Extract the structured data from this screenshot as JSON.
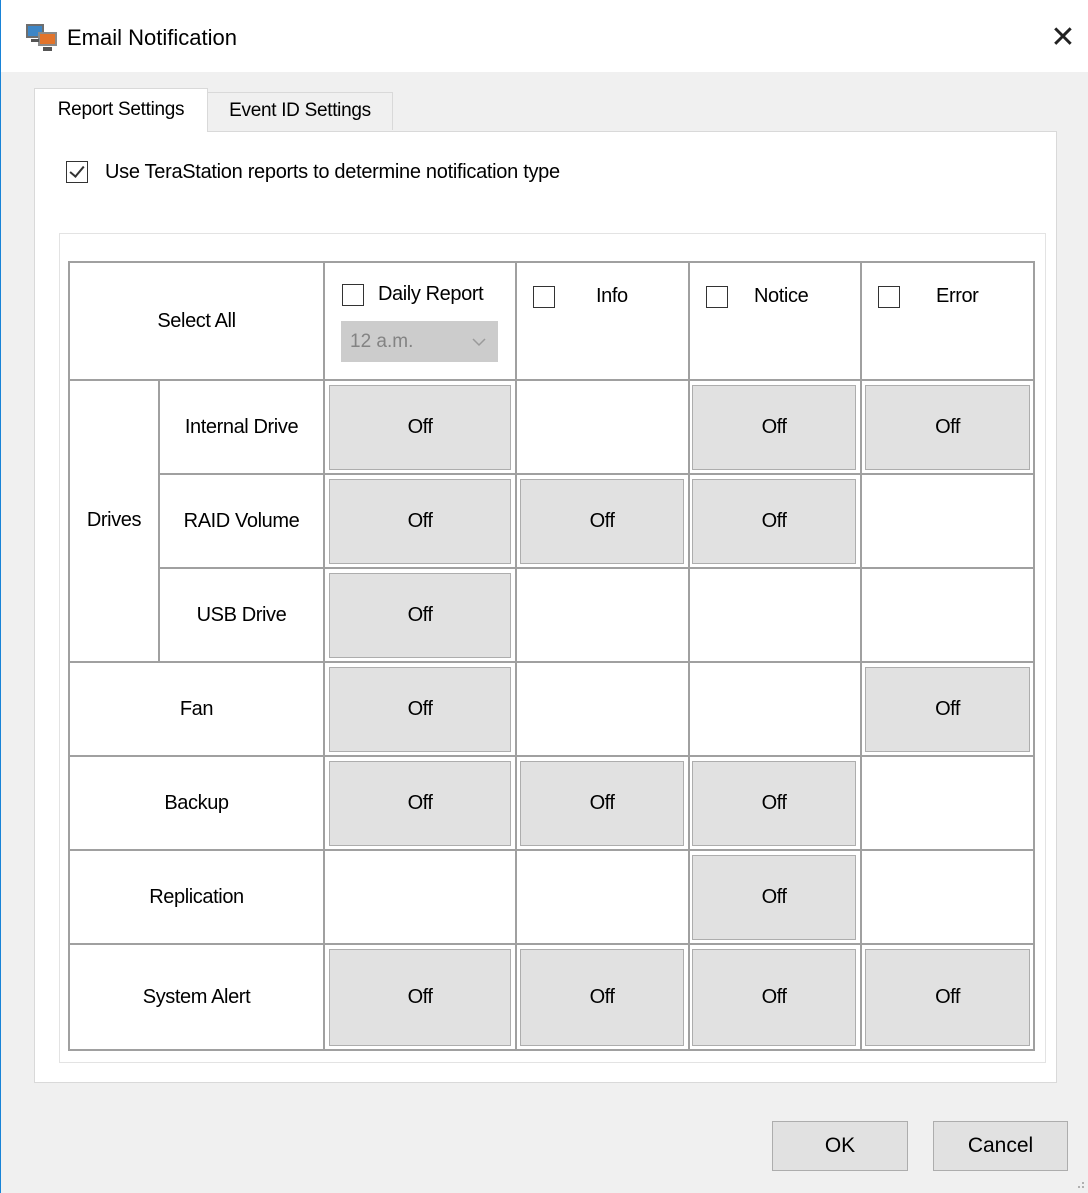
{
  "window": {
    "title": "Email Notification",
    "close_symbol": "✕",
    "app_icon": "network-computer-icon"
  },
  "tabs": [
    {
      "label": "Report Settings",
      "active": true
    },
    {
      "label": "Event ID Settings",
      "active": false
    }
  ],
  "use_reports": {
    "label": "Use TeraStation reports to determine notification type",
    "checked": true
  },
  "header": {
    "select_all_label": "Select All",
    "columns": [
      {
        "label": "Daily Report",
        "checked": false
      },
      {
        "label": "Info",
        "checked": false
      },
      {
        "label": "Notice",
        "checked": false
      },
      {
        "label": "Error",
        "checked": false
      }
    ],
    "daily_time": {
      "value": "12 a.m.",
      "enabled": false
    }
  },
  "groups": {
    "drives_label": "Drives"
  },
  "rows": [
    {
      "label": "Internal Drive",
      "group": "Drives",
      "cells": [
        "Off",
        "",
        "Off",
        "Off"
      ]
    },
    {
      "label": "RAID Volume",
      "group": "Drives",
      "cells": [
        "Off",
        "Off",
        "Off",
        ""
      ]
    },
    {
      "label": "USB Drive",
      "group": "Drives",
      "cells": [
        "Off",
        "",
        "",
        ""
      ]
    },
    {
      "label": "Fan",
      "group": "",
      "cells": [
        "Off",
        "",
        "",
        "Off"
      ]
    },
    {
      "label": "Backup",
      "group": "",
      "cells": [
        "Off",
        "Off",
        "Off",
        ""
      ]
    },
    {
      "label": "Replication",
      "group": "",
      "cells": [
        "",
        "",
        "Off",
        ""
      ]
    },
    {
      "label": "System Alert",
      "group": "",
      "cells": [
        "Off",
        "Off",
        "Off",
        "Off"
      ]
    }
  ],
  "footer": {
    "ok_label": "OK",
    "cancel_label": "Cancel"
  }
}
